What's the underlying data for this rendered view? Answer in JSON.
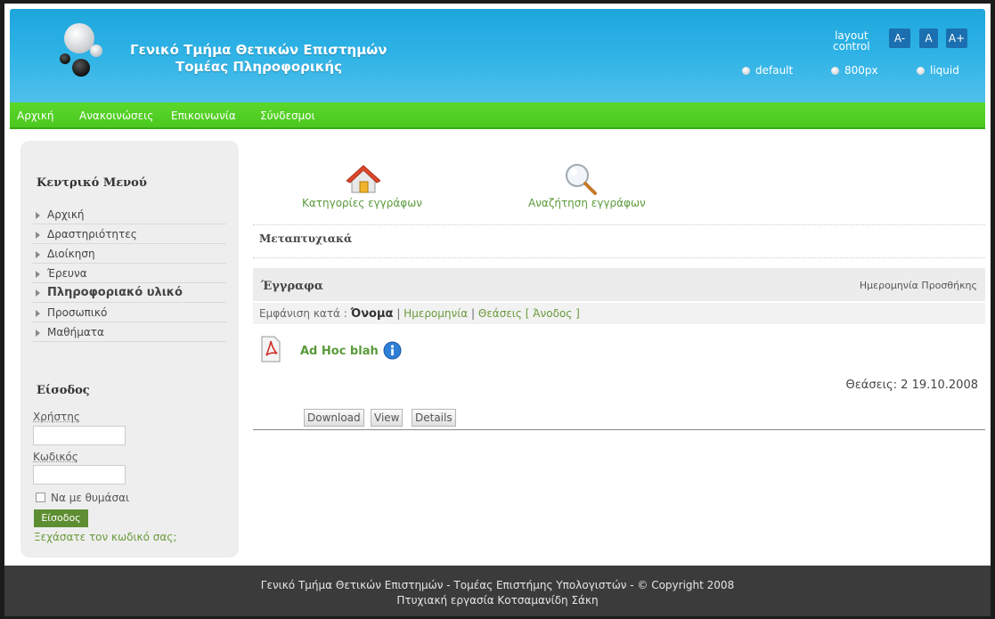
{
  "header": {
    "title_line1": "Γενικό Τμήμα Θετικών Επιστημών",
    "title_line2": "Τομέας Πληροφορικής",
    "layout_control_label_1": "layout",
    "layout_control_label_2": "control",
    "font_size_buttons": [
      "A-",
      "A",
      "A+"
    ],
    "width_options": [
      "default",
      "800px",
      "liquid"
    ]
  },
  "nav": {
    "items": [
      "Αρχική",
      "Ανακοινώσεις",
      "Επικοινωνία",
      "Σύνδεσμοι"
    ]
  },
  "sidebar": {
    "menu_title": "Κεντρικό Μενού",
    "items": [
      {
        "label": "Αρχική",
        "bold": false
      },
      {
        "label": "Δραστηριότητες",
        "bold": false
      },
      {
        "label": "Διοίκηση",
        "bold": false
      },
      {
        "label": "Έρευνα",
        "bold": false
      },
      {
        "label": "Πληροφοριακό υλικό",
        "bold": true
      },
      {
        "label": "Προσωπικό",
        "bold": false
      },
      {
        "label": "Μαθήματα",
        "bold": false
      }
    ],
    "login_title": "Είσοδος",
    "username_label": "Χρήστης",
    "password_label": "Κωδικός",
    "remember_label": "Να με θυμάσαι",
    "login_button": "Είσοδος",
    "forgot_link": "Ξεχάσατε τον κωδικό σας;"
  },
  "main": {
    "categories_link": "Κατηγορίες εγγράφων",
    "search_link": "Αναζήτηση εγγράφων",
    "section_title": "Μεταπτυχιακά",
    "docs_header": "Έγγραφα",
    "date_added_label": "Ημερομηνία Προσθήκης",
    "sort": {
      "prefix": "Εμφάνιση κατά : ",
      "current": "Όνομα",
      "sep1": " | ",
      "date": "Ημερομηνία",
      "sep2": " | ",
      "views": "Θεάσεις",
      "order": "[ Άνοδος ]"
    },
    "document": {
      "name": "Ad Hoc blah",
      "views_label": "Θεάσεις: 2",
      "date": "19.10.2008",
      "buttons": [
        "Download",
        "View",
        "Details"
      ]
    }
  },
  "footer": {
    "line1": "Γενικό Τμήμα Θετικών Επιστημών - Τομέας Επιστήμης Υπολογιστών - © Copyright 2008",
    "line2": "Πτυχιακή εργασία Κοτσαμανίδη Σάκη"
  },
  "colors": {
    "header_blue": "#2db2e6",
    "nav_green": "#4bc81f",
    "link_green": "#5a9a3a",
    "footer_gray": "#3b3b3b"
  },
  "icons": [
    "home-icon",
    "magnifier-icon",
    "pdf-icon",
    "info-icon"
  ]
}
